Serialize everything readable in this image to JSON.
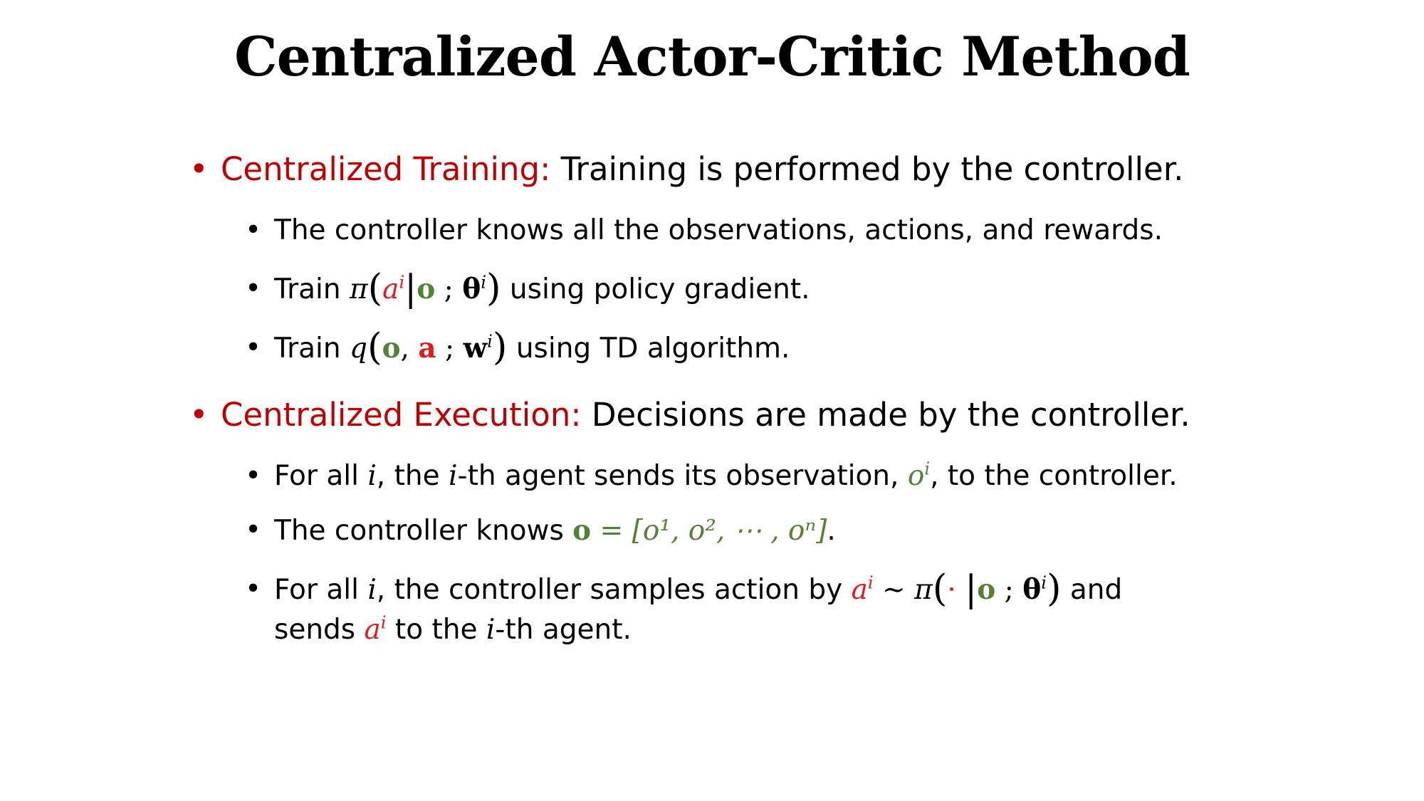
{
  "title": "Centralized Actor-Critic Method",
  "bullet_char": "•",
  "training": {
    "heading": "Centralized Training:",
    "text": "Training is performed by the controller.",
    "sub1": "The controller knows all the observations, actions, and rewards.",
    "sub2": {
      "prefix": "Train",
      "pi": "π",
      "lparen": "(",
      "a": "a",
      "sup_i": "i",
      "bar": "|",
      "o": "o",
      "semi": ";",
      "theta": "θ",
      "rparen": ")",
      "suffix": "using policy gradient."
    },
    "sub3": {
      "prefix": "Train",
      "q": "q",
      "lparen": "(",
      "o": "o",
      "comma": ",",
      "a": "a",
      "semi": ";",
      "w": "w",
      "sup_i": "i",
      "rparen": ")",
      "suffix": "using TD algorithm."
    }
  },
  "execution": {
    "heading": "Centralized Execution:",
    "text": "Decisions are made by the controller.",
    "sub1": {
      "p1": "For all",
      "i": "i",
      "p2": ", the",
      "p3": "-th agent sends its observation,",
      "o": "o",
      "sup_i": "i",
      "p4": ", to the controller."
    },
    "sub2": {
      "prefix": "The controller knows",
      "formula_lhs": "o",
      "formula_rhs": "= [o¹, o², ⋯ , oⁿ]",
      "suffix": "."
    },
    "sub3": {
      "p1": "For all",
      "i": "i",
      "p2": ", the controller samples action by",
      "a": "a",
      "sup_i": "i",
      "tilde": "∼",
      "pi": "π",
      "lparen": "(",
      "dot": "·",
      "bar": "|",
      "o": "o",
      "semi": ";",
      "theta": "θ",
      "rparen": ")",
      "p3": "and",
      "line2_p1": "sends",
      "line2_p2": "to the",
      "line2_p3": "-th agent."
    }
  }
}
